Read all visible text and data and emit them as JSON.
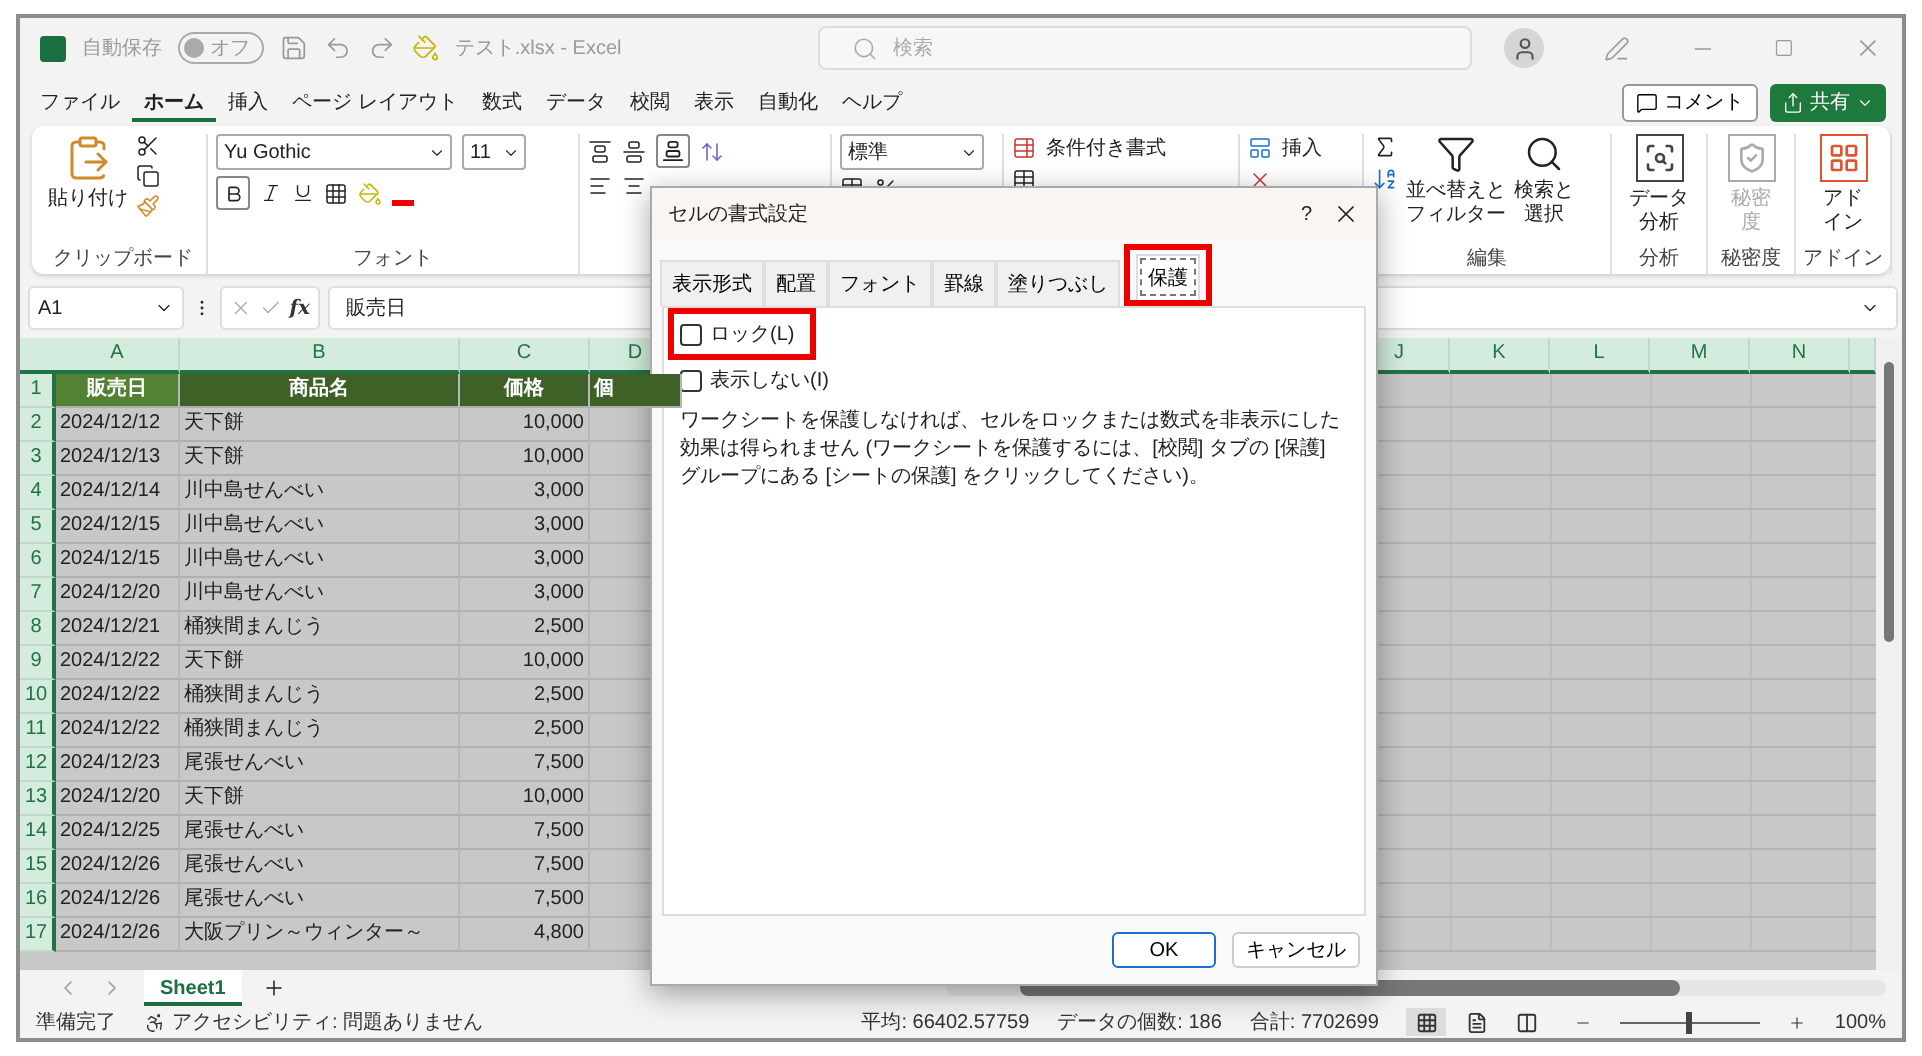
{
  "title_bar": {
    "autosave_label": "自動保存",
    "autosave_toggle": {
      "label": "オフ",
      "on": false
    },
    "file_title": "テスト.xlsx  -  Excel",
    "search": {
      "placeholder": "検索"
    }
  },
  "menu_tabs": [
    {
      "label": "ファイル",
      "selected": false
    },
    {
      "label": "ホーム",
      "selected": true
    },
    {
      "label": "挿入",
      "selected": false
    },
    {
      "label": "ページ レイアウト",
      "selected": false
    },
    {
      "label": "数式",
      "selected": false
    },
    {
      "label": "データ",
      "selected": false
    },
    {
      "label": "校閲",
      "selected": false
    },
    {
      "label": "表示",
      "selected": false
    },
    {
      "label": "自動化",
      "selected": false
    },
    {
      "label": "ヘルプ",
      "selected": false
    }
  ],
  "comment_button": "コメント",
  "share_button": "共有",
  "ribbon": {
    "clipboard": {
      "paste": "貼り付け",
      "label": "クリップボード"
    },
    "font": {
      "font_name": "Yu Gothic",
      "font_size": "11",
      "label": "フォント"
    },
    "number": {
      "format": "標準"
    },
    "styles": {
      "conditional": "条件付き書式"
    },
    "cells": {
      "insert": "挿入"
    },
    "editing": {
      "sort": "並べ替えとフィルター",
      "find": "検索と選択",
      "label": "編集"
    },
    "big_groups": [
      {
        "kind": "analysis",
        "button": "データ分析",
        "label": "分析",
        "disabled": false
      },
      {
        "kind": "sensitivity",
        "button": "秘密度",
        "label": "秘密度",
        "disabled": true
      },
      {
        "kind": "addin",
        "button": "アドイン",
        "label": "アドイン",
        "disabled": false
      }
    ]
  },
  "formula_bar": {
    "name_box": "A1",
    "fx": "fx",
    "formula": "販売日"
  },
  "sheet": {
    "columns_left": [
      "A",
      "B",
      "C",
      "D"
    ],
    "columns_right": [
      "J",
      "K",
      "L",
      "M",
      "N"
    ],
    "rows": [
      {
        "number": "1",
        "kind": "header",
        "cells": [
          "販売日",
          "商品名",
          "価格",
          "個"
        ]
      },
      {
        "number": "2",
        "kind": "data",
        "cells": [
          "2024/12/12",
          "天下餅",
          "10,000"
        ]
      },
      {
        "number": "3",
        "kind": "data",
        "cells": [
          "2024/12/13",
          "天下餅",
          "10,000"
        ]
      },
      {
        "number": "4",
        "kind": "data",
        "cells": [
          "2024/12/14",
          "川中島せんべい",
          "3,000"
        ]
      },
      {
        "number": "5",
        "kind": "data",
        "cells": [
          "2024/12/15",
          "川中島せんべい",
          "3,000"
        ]
      },
      {
        "number": "6",
        "kind": "data",
        "cells": [
          "2024/12/15",
          "川中島せんべい",
          "3,000"
        ]
      },
      {
        "number": "7",
        "kind": "data",
        "cells": [
          "2024/12/20",
          "川中島せんべい",
          "3,000"
        ]
      },
      {
        "number": "8",
        "kind": "data",
        "cells": [
          "2024/12/21",
          "桶狭間まんじう",
          "2,500"
        ]
      },
      {
        "number": "9",
        "kind": "data",
        "cells": [
          "2024/12/22",
          "天下餅",
          "10,000"
        ]
      },
      {
        "number": "10",
        "kind": "data",
        "cells": [
          "2024/12/22",
          "桶狭間まんじう",
          "2,500"
        ]
      },
      {
        "number": "11",
        "kind": "data",
        "cells": [
          "2024/12/22",
          "桶狭間まんじう",
          "2,500"
        ]
      },
      {
        "number": "12",
        "kind": "data",
        "cells": [
          "2024/12/23",
          "尾張せんべい",
          "7,500"
        ]
      },
      {
        "number": "13",
        "kind": "data",
        "cells": [
          "2024/12/20",
          "天下餅",
          "10,000"
        ]
      },
      {
        "number": "14",
        "kind": "data",
        "cells": [
          "2024/12/25",
          "尾張せんべい",
          "7,500"
        ]
      },
      {
        "number": "15",
        "kind": "data",
        "cells": [
          "2024/12/26",
          "尾張せんべい",
          "7,500"
        ]
      },
      {
        "number": "16",
        "kind": "data",
        "cells": [
          "2024/12/26",
          "尾張せんべい",
          "7,500"
        ]
      },
      {
        "number": "17",
        "kind": "data",
        "cells": [
          "2024/12/26",
          "大阪プリン～ウィンター～",
          "4,800"
        ]
      }
    ]
  },
  "sheet_tabs": [
    {
      "label": "Sheet1",
      "selected": true
    }
  ],
  "status_bar": {
    "ready": "準備完了",
    "accessibility": "アクセシビリティ: 問題ありません",
    "average": "平均: 66402.57759",
    "count": "データの個数: 186",
    "sum": "合計: 7702699",
    "views": [
      {
        "kind": "normal",
        "selected": true
      },
      {
        "kind": "page_layout",
        "selected": false
      },
      {
        "kind": "page_break",
        "selected": false
      }
    ],
    "zoom": {
      "level": 0.47,
      "reading": "100%"
    }
  },
  "dialog": {
    "title": "セルの書式設定",
    "help": "?",
    "tabs": [
      {
        "label": "表示形式",
        "selected": false,
        "highlighted": false
      },
      {
        "label": "配置",
        "selected": false,
        "highlighted": false
      },
      {
        "label": "フォント",
        "selected": false,
        "highlighted": false
      },
      {
        "label": "罫線",
        "selected": false,
        "highlighted": false
      },
      {
        "label": "塗りつぶし",
        "selected": false,
        "highlighted": false
      },
      {
        "label": "保護",
        "selected": true,
        "highlighted": true
      }
    ],
    "options": [
      {
        "label": "ロック(L)",
        "checked": false,
        "highlighted": true
      },
      {
        "label": "表示しない(I)",
        "checked": false,
        "highlighted": false
      }
    ],
    "note": "ワークシートを保護しなければ、セルをロックまたは数式を非表示にした効果は得られません (ワークシートを保護するには、[校閲] タブの [保護] グループにある [シートの保護] をクリックしてください)。",
    "buttons": [
      {
        "label": "OK",
        "default": true
      },
      {
        "label": "キャンセル",
        "default": false
      }
    ]
  }
}
